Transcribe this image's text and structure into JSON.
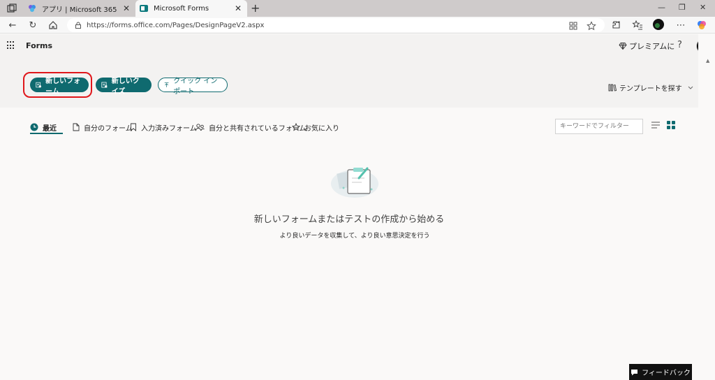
{
  "browser": {
    "tabs": [
      {
        "title": "アプリ | Microsoft 365",
        "active": false
      },
      {
        "title": "Microsoft Forms",
        "active": true
      }
    ],
    "url": "https://forms.office.com/Pages/DesignPageV2.aspx",
    "new_tab_symbol": "+",
    "close_symbol": "✕",
    "window_controls": {
      "minimize": "—",
      "restore": "❐",
      "close": "✕"
    }
  },
  "app": {
    "title": "Forms",
    "premium_label": "プレミアムに",
    "help_symbol": "?"
  },
  "hero": {
    "new_form_label": "新しいフォーム",
    "new_quiz_label": "新しいクイズ",
    "quick_import_label": "クイック インポート",
    "templates_label": "テンプレートを探す"
  },
  "filter_tabs": [
    {
      "label": "最近",
      "icon": "clock-icon",
      "active": true
    },
    {
      "label": "自分のフォーム",
      "icon": "document-icon",
      "active": false
    },
    {
      "label": "入力済みフォーム",
      "icon": "bookmark-icon",
      "active": false
    },
    {
      "label": "自分と共有されているフォーム",
      "icon": "people-icon",
      "active": false
    },
    {
      "label": "お気に入り",
      "icon": "star-icon",
      "active": false
    }
  ],
  "filter": {
    "placeholder": "キーワードでフィルター"
  },
  "empty_state": {
    "title": "新しいフォームまたはテストの作成から始める",
    "subtitle": "より良いデータを収集して、より良い意思決定を行う"
  },
  "feedback_label": "フィードバック",
  "colors": {
    "accent": "#0f6a6f",
    "highlight": "#e0171b"
  }
}
